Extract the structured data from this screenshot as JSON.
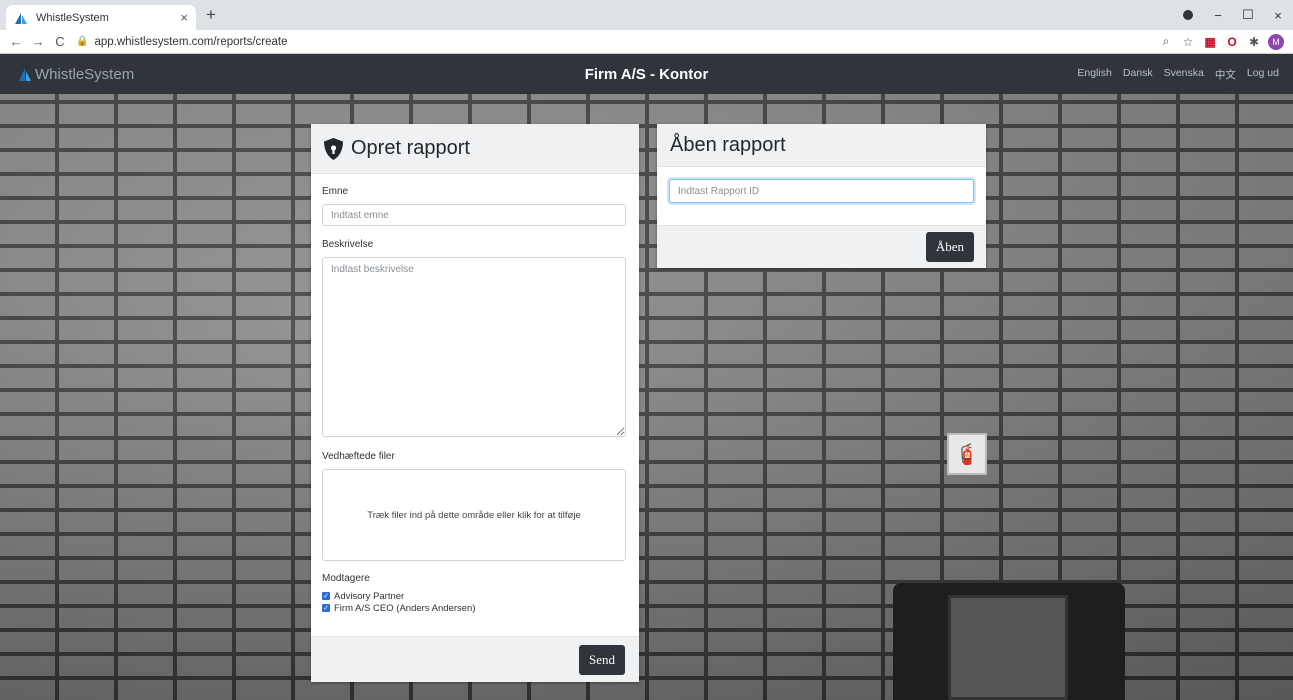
{
  "browser": {
    "tab_title": "WhistleSystem",
    "tab_close": "×",
    "new_tab": "+",
    "url": "app.whistlesystem.com/reports/create",
    "nav": {
      "back": "←",
      "forward": "→",
      "reload": "C"
    },
    "window": {
      "minimize": "−",
      "maximize": "☐",
      "close": "×"
    }
  },
  "navbar": {
    "brand": "WhistleSystem",
    "title": "Firm A/S - Kontor",
    "links": [
      "English",
      "Dansk",
      "Svenska",
      "中文",
      "Log ud"
    ]
  },
  "create_report": {
    "title": "Opret rapport",
    "subject_label": "Emne",
    "subject_placeholder": "Indtast emne",
    "description_label": "Beskrivelse",
    "description_placeholder": "Indtast beskrivelse",
    "attachments_label": "Vedhæftede filer",
    "dropzone_text": "Træk filer ind på dette område eller klik for at tilføje",
    "recipients_label": "Modtagere",
    "recipients": [
      {
        "name": "Advisory Partner",
        "checked": true
      },
      {
        "name": "Firm A/S CEO (Anders Andersen)",
        "checked": true
      }
    ],
    "send_label": "Send"
  },
  "open_report": {
    "title": "Åben rapport",
    "id_placeholder": "Indtast Rapport ID",
    "open_label": "Åben"
  },
  "colors": {
    "navbar": "#2f353b",
    "button": "#2f353b",
    "checkbox": "#2d6cdf",
    "brand_logo": "#2a8cd8"
  }
}
